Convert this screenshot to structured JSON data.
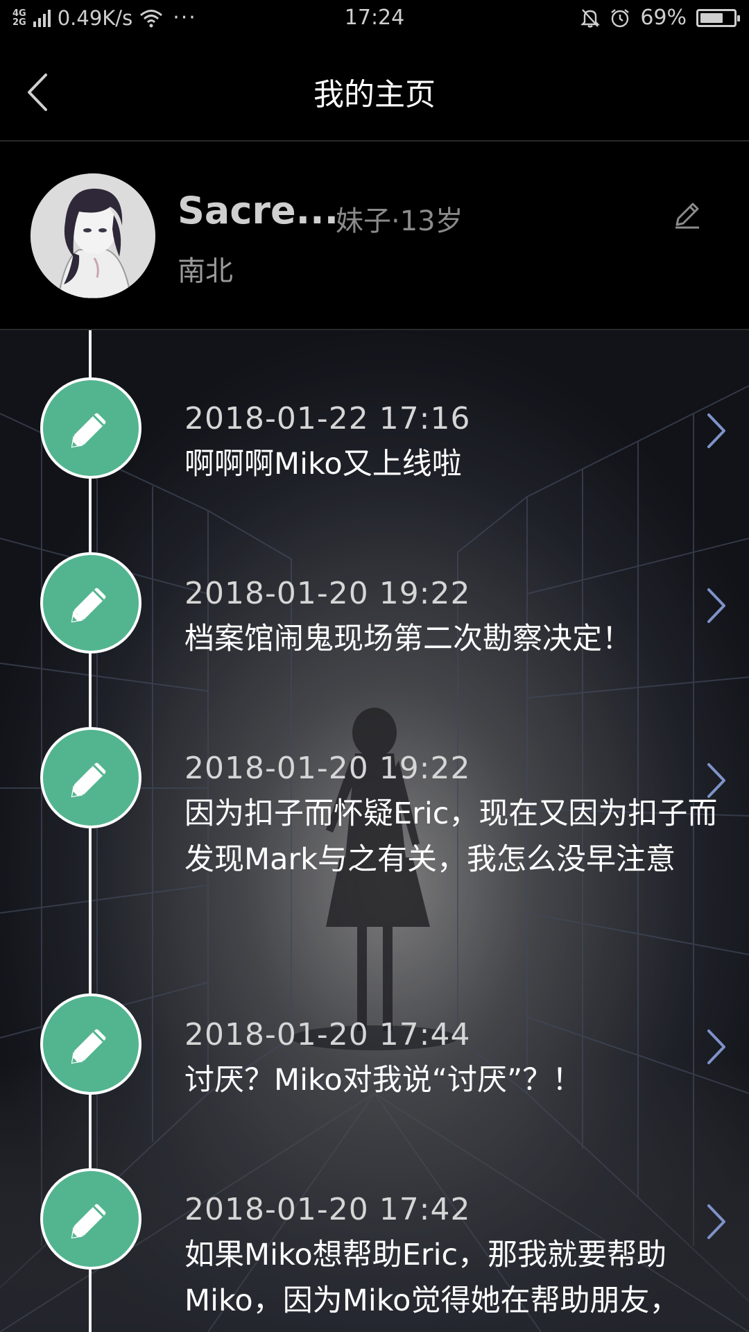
{
  "status_bar": {
    "network_type_top": "4G",
    "network_type_bottom": "2G",
    "speed": "0.49K/s",
    "dots": "···",
    "time": "17:24",
    "battery_percent": "69%",
    "battery_level": 0.69,
    "icons": [
      "signal-icon",
      "wifi-icon",
      "mute-bell-icon",
      "alarm-icon",
      "battery-icon"
    ]
  },
  "header": {
    "title": "我的主页",
    "back_icon": "chevron-left-icon"
  },
  "profile": {
    "nickname": "Sacre...",
    "gender_age": "妹子·13岁",
    "location": "南北",
    "edit_icon": "pencil-icon"
  },
  "entries": [
    {
      "date": "2018-01-22 17:16",
      "text": "啊啊啊Miko又上线啦"
    },
    {
      "date": "2018-01-20 19:22",
      "text": "档案馆闹鬼现场第二次勘察决定！"
    },
    {
      "date": "2018-01-20 19:22",
      "text": "因为扣子而怀疑Eric，现在又因为扣子而发现Mark与之有关，我怎么没早注意"
    },
    {
      "date": "2018-01-20 17:44",
      "text": "讨厌？Miko对我说“讨厌”？！"
    },
    {
      "date": "2018-01-20 17:42",
      "text": "如果Miko想帮助Eric，那我就要帮助Miko，因为Miko觉得她在帮助朋友，"
    }
  ],
  "colors": {
    "accent_green": "#53b590",
    "arrow_blue": "#7f93c9",
    "background": "#000000"
  }
}
